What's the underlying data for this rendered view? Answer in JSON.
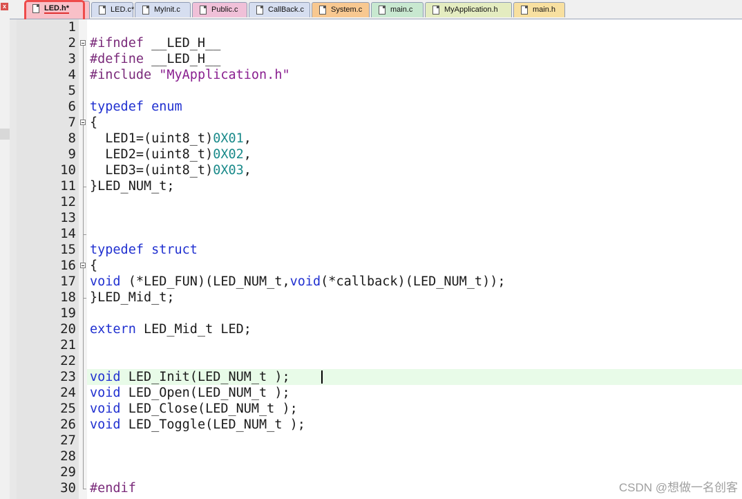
{
  "window": {
    "close_glyph": "x"
  },
  "tabs": [
    {
      "label": "LED.h*",
      "active": true,
      "color": "#f8c0c8"
    },
    {
      "label": "LED.c*",
      "color": "#d6def0"
    },
    {
      "label": "MyInit.c",
      "color": "#d6def0"
    },
    {
      "label": "Public.c",
      "color": "#f0c0d8"
    },
    {
      "label": "CallBack.c",
      "color": "#d6def0"
    },
    {
      "label": "System.c",
      "color": "#f8c890"
    },
    {
      "label": "main.c",
      "color": "#c8e8d0"
    },
    {
      "label": "MyApplication.h",
      "color": "#e4ecc0"
    },
    {
      "label": "main.h",
      "color": "#f8e0a0"
    }
  ],
  "editor": {
    "line_numbers": [
      "1",
      "2",
      "3",
      "4",
      "5",
      "6",
      "7",
      "8",
      "9",
      "10",
      "11",
      "12",
      "13",
      "14",
      "15",
      "16",
      "17",
      "18",
      "19",
      "20",
      "21",
      "22",
      "23",
      "24",
      "25",
      "26",
      "27",
      "28",
      "29",
      "30"
    ],
    "current_line": "23",
    "lines": [
      "",
      "#ifndef __LED_H__",
      "#define __LED_H__",
      "#include \"MyApplication.h\"",
      "",
      "typedef enum",
      "{",
      "  LED1=(uint8_t)0X01,",
      "  LED2=(uint8_t)0X02,",
      "  LED3=(uint8_t)0X03,",
      "}LED_NUM_t;",
      "",
      "",
      "",
      "typedef struct",
      "{",
      "void (*LED_FUN)(LED_NUM_t,void(*callback)(LED_NUM_t));",
      "}LED_Mid_t;",
      "",
      "extern LED_Mid_t LED;",
      "",
      "",
      "void LED_Init(LED_NUM_t );",
      "void LED_Open(LED_NUM_t );",
      "void LED_Close(LED_NUM_t );",
      "void LED_Toggle(LED_NUM_t );",
      "",
      "",
      "",
      "#endif"
    ]
  },
  "watermark": "CSDN @想做一名创客"
}
